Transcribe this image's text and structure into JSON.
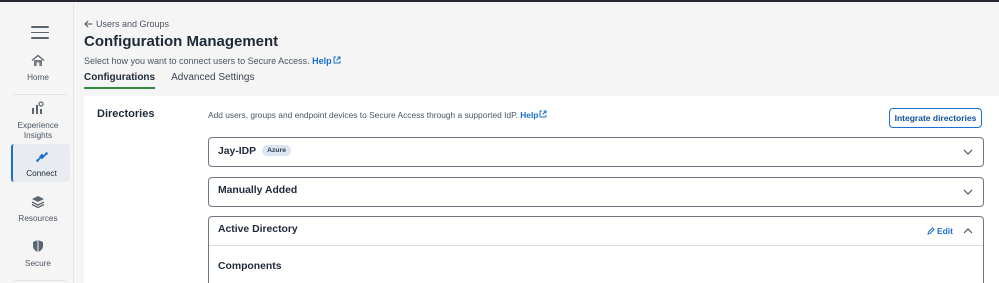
{
  "sidebar": {
    "items": [
      {
        "label": "Home",
        "icon": "home-icon"
      },
      {
        "label": "Experience Insights",
        "icon": "insights-icon"
      },
      {
        "label": "Connect",
        "icon": "connect-icon",
        "active": true
      },
      {
        "label": "Resources",
        "icon": "resources-icon"
      },
      {
        "label": "Secure",
        "icon": "shield-icon"
      }
    ]
  },
  "header": {
    "back_label": "Users and Groups",
    "title": "Configuration Management",
    "subtitle": "Select how you want to connect users to Secure Access.",
    "help_label": "Help"
  },
  "tabs": [
    {
      "label": "Configurations",
      "active": true
    },
    {
      "label": "Advanced Settings",
      "active": false
    }
  ],
  "directories": {
    "title": "Directories",
    "description": "Add users, groups and endpoint devices to Secure Access through a supported IdP.",
    "help_label": "Help",
    "integrate_button": "Integrate directories",
    "items": [
      {
        "name": "Jay-IDP",
        "badge": "Azure",
        "expanded": false
      },
      {
        "name": "Manually Added",
        "expanded": false
      },
      {
        "name": "Active Directory",
        "expanded": true,
        "edit_label": "Edit",
        "section": "Components"
      }
    ]
  },
  "colors": {
    "accent": "#1b6fd1",
    "tab_underline": "#2f8a3b",
    "badge_bg": "#dbe5f2"
  }
}
